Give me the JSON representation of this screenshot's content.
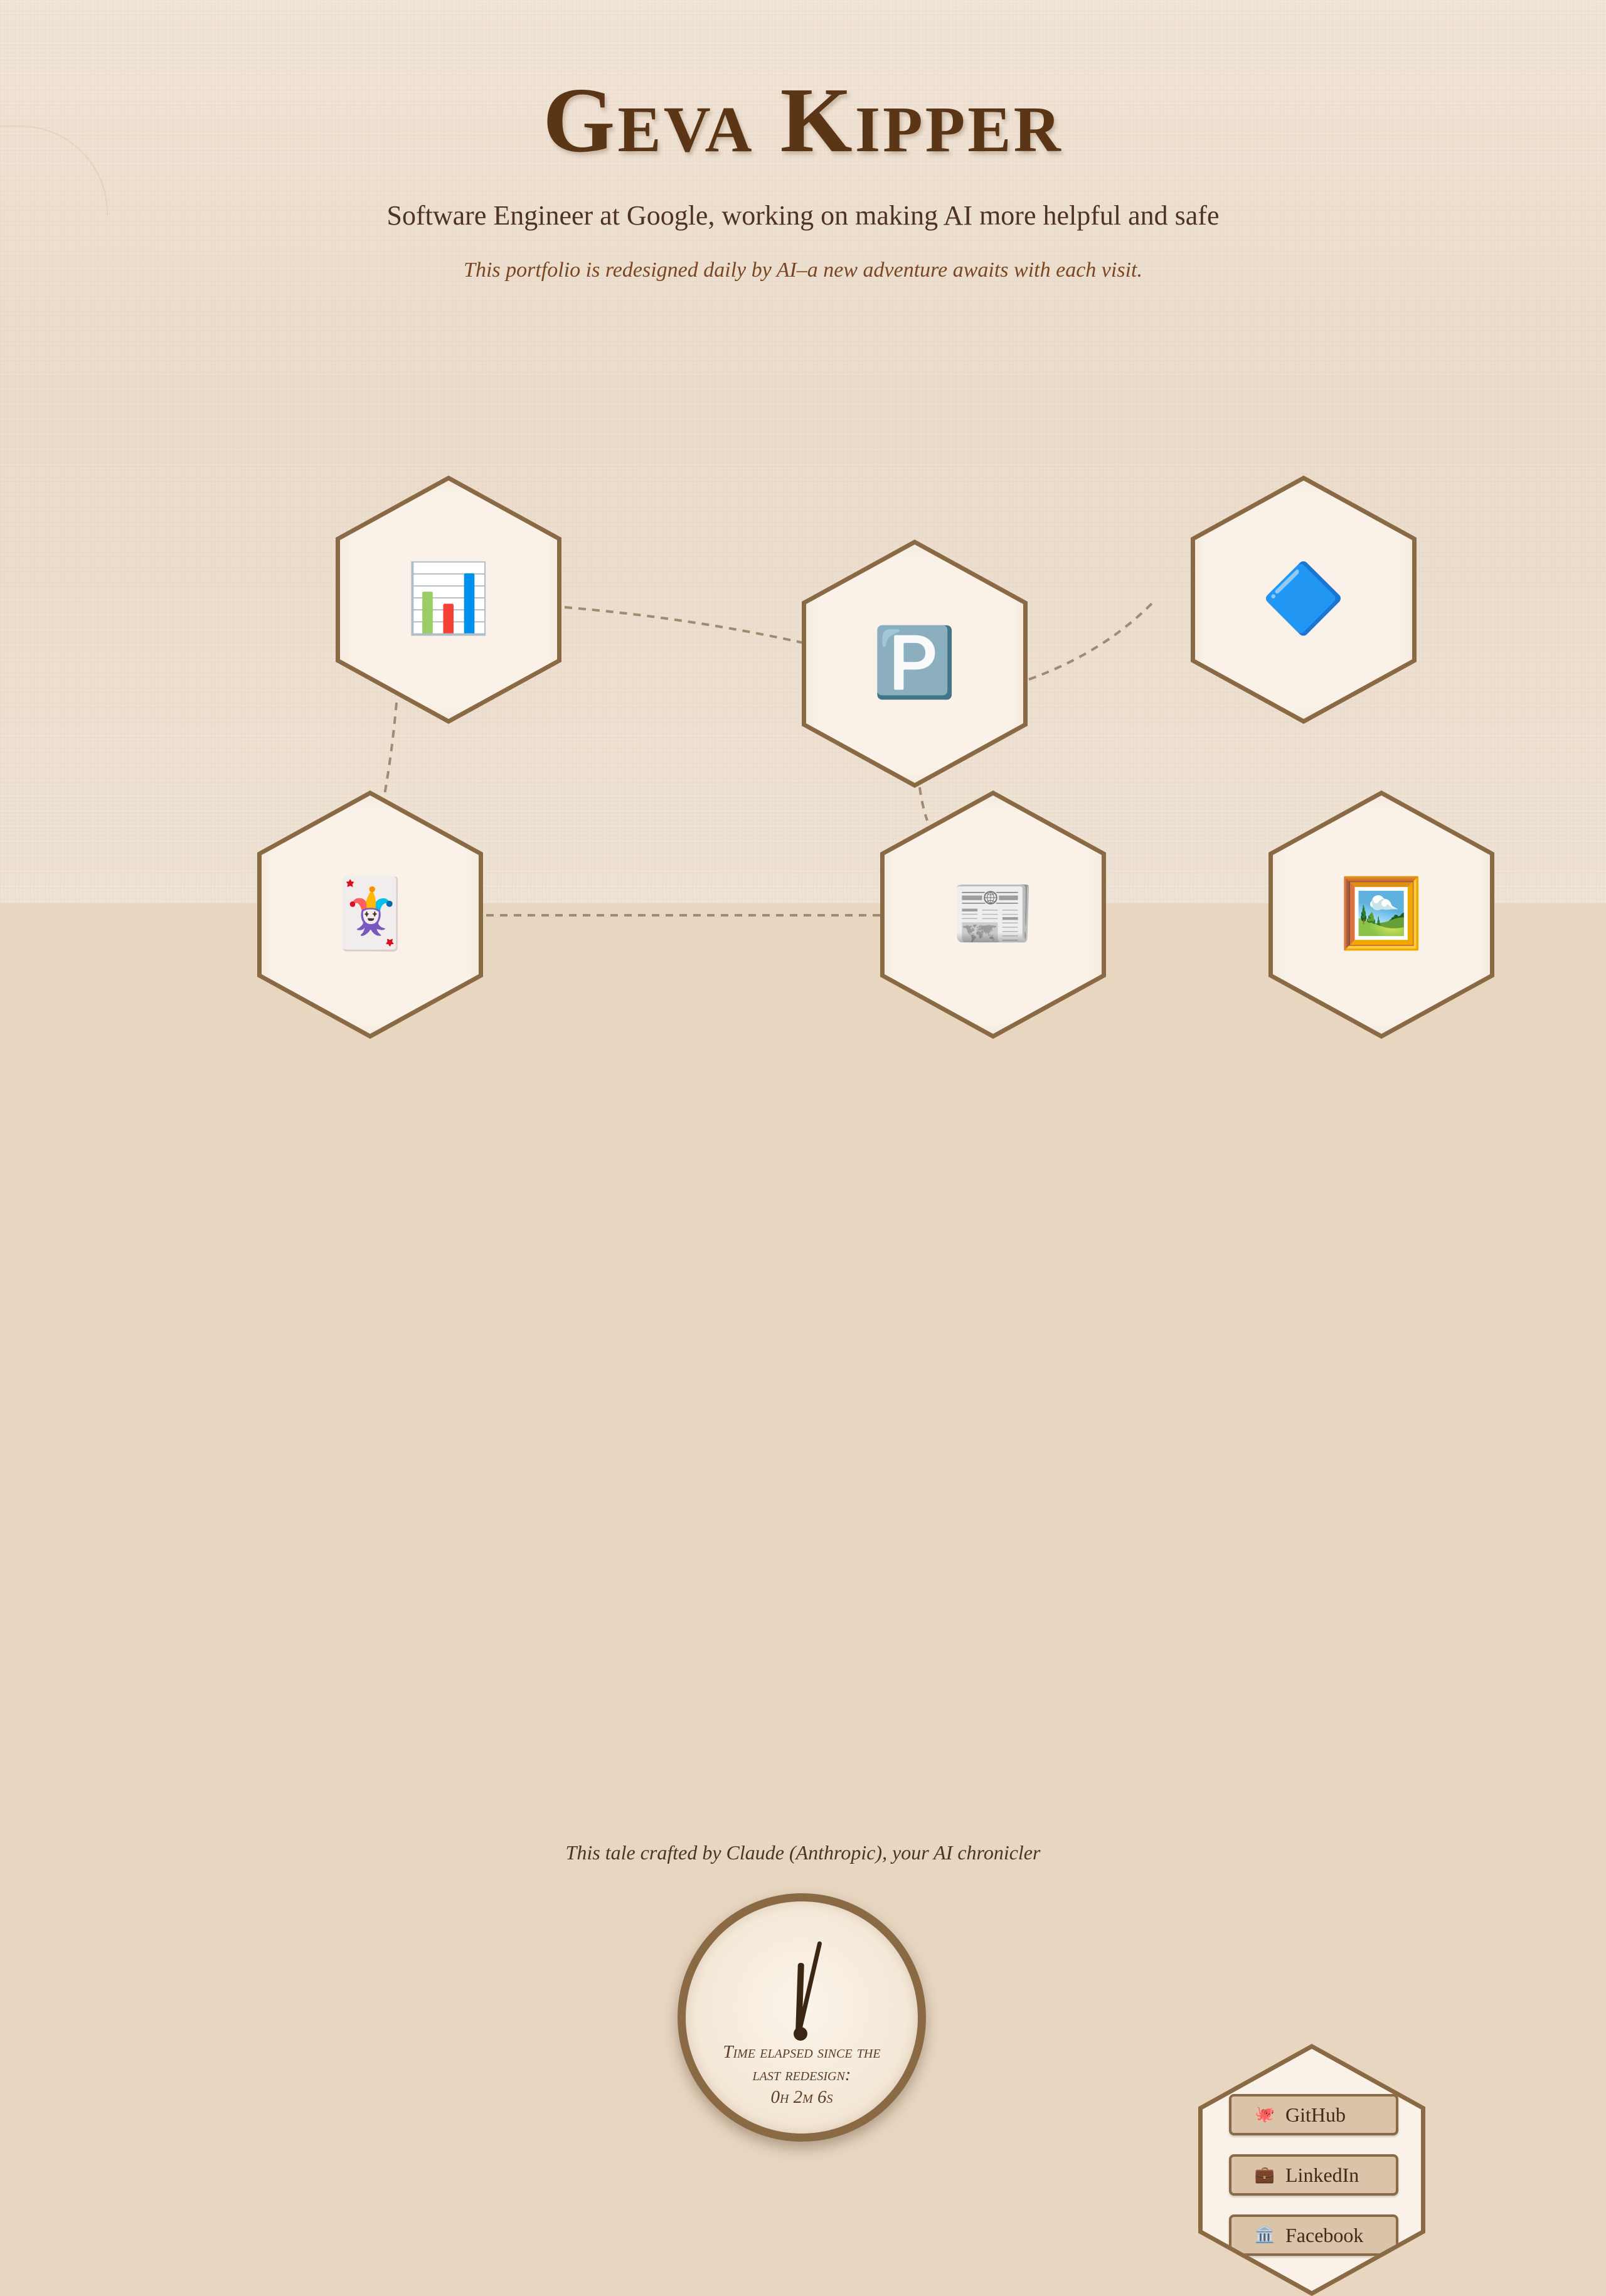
{
  "header": {
    "title": "Geva Kipper",
    "subtitle": "Software Engineer at Google, working on making AI more helpful and safe",
    "note": "This portfolio is redesigned daily by AI–a new adventure awaits with each visit."
  },
  "projects": [
    {
      "icon_name": "bar-chart-icon",
      "glyph": "📊"
    },
    {
      "icon_name": "p-button-icon",
      "glyph": "🅿️"
    },
    {
      "icon_name": "blue-diamond-icon",
      "glyph": "🔷"
    },
    {
      "icon_name": "joker-card-icon",
      "glyph": "🃏"
    },
    {
      "icon_name": "newspaper-icon",
      "glyph": "📰"
    },
    {
      "icon_name": "framed-picture-icon",
      "glyph": "🖼️"
    }
  ],
  "footer": {
    "credit": "This tale crafted by Claude (Anthropic), your AI chronicler",
    "clock": {
      "label": "Time elapsed since the last redesign:",
      "elapsed": "0h 2m 6s"
    }
  },
  "links": [
    {
      "label": "GitHub",
      "icon_name": "octopus-icon",
      "glyph": "🐙"
    },
    {
      "label": "LinkedIn",
      "icon_name": "briefcase-icon",
      "glyph": "💼"
    },
    {
      "label": "Facebook",
      "icon_name": "classical-building-icon",
      "glyph": "🏛️"
    }
  ],
  "colors": {
    "background": "#e8d6c1",
    "accent": "#8a6a45",
    "title": "#5a3516",
    "hex_face": "#faf2e8"
  }
}
